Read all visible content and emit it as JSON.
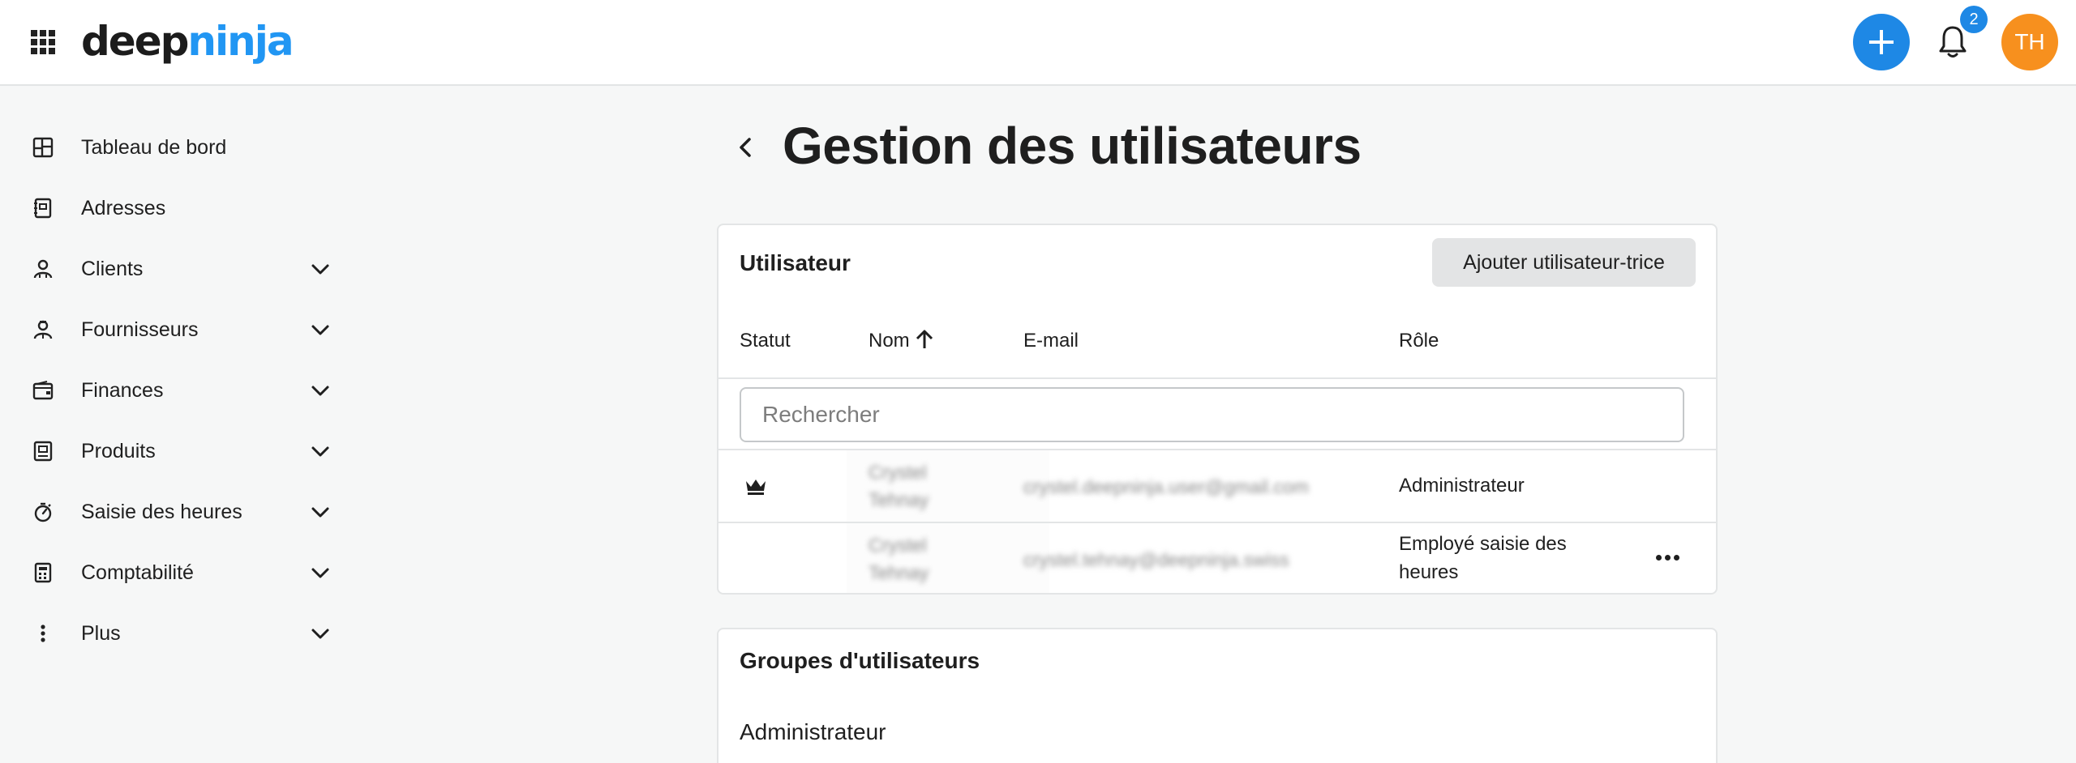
{
  "header": {
    "logo_part1": "deep",
    "logo_part2": "ninja",
    "notification_count": "2",
    "avatar_initials": "TH",
    "accent_color": "#1e88e5",
    "avatar_color": "#f7901e"
  },
  "sidebar": {
    "items": [
      {
        "label": "Tableau de bord",
        "icon": "dashboard-icon",
        "expandable": false
      },
      {
        "label": "Adresses",
        "icon": "address-book-icon",
        "expandable": false
      },
      {
        "label": "Clients",
        "icon": "clients-icon",
        "expandable": true
      },
      {
        "label": "Fournisseurs",
        "icon": "suppliers-icon",
        "expandable": true
      },
      {
        "label": "Finances",
        "icon": "wallet-icon",
        "expandable": true
      },
      {
        "label": "Produits",
        "icon": "products-icon",
        "expandable": true
      },
      {
        "label": "Saisie des heures",
        "icon": "stopwatch-icon",
        "expandable": true
      },
      {
        "label": "Comptabilité",
        "icon": "calculator-icon",
        "expandable": true
      },
      {
        "label": "Plus",
        "icon": "more-vertical-icon",
        "expandable": true
      }
    ]
  },
  "page": {
    "title": "Gestion des utilisateurs"
  },
  "users": {
    "title": "Utilisateur",
    "add_button": "Ajouter utilisateur-trice",
    "columns": {
      "status": "Statut",
      "name": "Nom",
      "email": "E-mail",
      "role": "Rôle"
    },
    "search_placeholder": "Rechercher",
    "rows": [
      {
        "status_icon": "crown-icon",
        "name_line1": "Crystel",
        "name_line2": "Tehnay",
        "email": "crystel.deepninja.user@gmail.com",
        "role": "Administrateur"
      },
      {
        "status_icon": "",
        "name_line1": "Crystel",
        "name_line2": "Tehnay",
        "email": "crystel.tehnay@deepninja.swiss",
        "role": "Employé saisie des heures"
      }
    ]
  },
  "groups": {
    "title": "Groupes d'utilisateurs",
    "items": [
      "Administrateur"
    ]
  }
}
